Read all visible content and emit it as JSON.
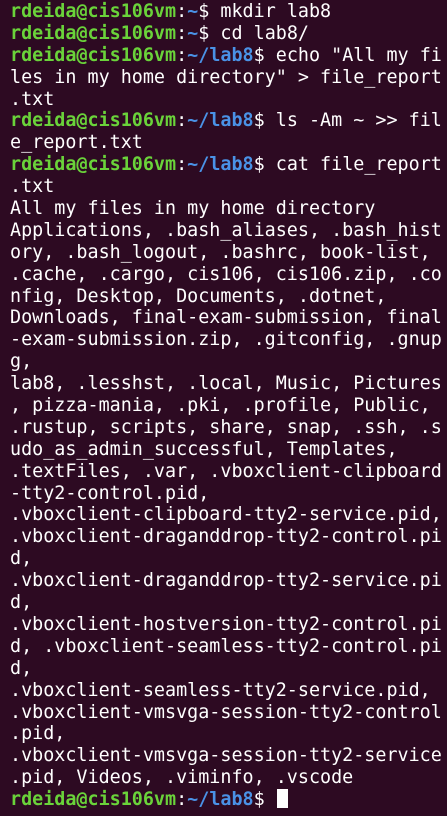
{
  "colors": {
    "background": "#2d0a22",
    "prompt_user": "#6ad33a",
    "prompt_path": "#4a92e6",
    "text": "#ffffff"
  },
  "prompt": {
    "userhost": "rdeida@cis106vm",
    "colon": ":",
    "dollar": "$"
  },
  "lines": [
    {
      "type": "prompt",
      "path": "~",
      "cmd": " mkdir lab8"
    },
    {
      "type": "prompt",
      "path": "~",
      "cmd": " cd lab8/"
    },
    {
      "type": "prompt",
      "path": "~/lab8",
      "cmd": " echo \"All my fi"
    },
    {
      "type": "output",
      "text": "les in my home directory\" > file_report"
    },
    {
      "type": "output",
      "text": ".txt"
    },
    {
      "type": "prompt",
      "path": "~/lab8",
      "cmd": " ls -Am ~ >> fil"
    },
    {
      "type": "output",
      "text": "e_report.txt"
    },
    {
      "type": "prompt",
      "path": "~/lab8",
      "cmd": " cat file_report"
    },
    {
      "type": "output",
      "text": ".txt"
    },
    {
      "type": "output",
      "text": "All my files in my home directory"
    },
    {
      "type": "output",
      "text": "Applications, .bash_aliases, .bash_hist"
    },
    {
      "type": "output",
      "text": "ory, .bash_logout, .bashrc, book-list,"
    },
    {
      "type": "output",
      "text": ".cache, .cargo, cis106, cis106.zip, .co"
    },
    {
      "type": "output",
      "text": "nfig, Desktop, Documents, .dotnet,"
    },
    {
      "type": "output",
      "text": "Downloads, final-exam-submission, final"
    },
    {
      "type": "output",
      "text": "-exam-submission.zip, .gitconfig, .gnup"
    },
    {
      "type": "output",
      "text": "g,"
    },
    {
      "type": "output",
      "text": "lab8, .lesshst, .local, Music, Pictures"
    },
    {
      "type": "output",
      "text": ", pizza-mania, .pki, .profile, Public,"
    },
    {
      "type": "output",
      "text": ".rustup, scripts, share, snap, .ssh, .s"
    },
    {
      "type": "output",
      "text": "udo_as_admin_successful, Templates,"
    },
    {
      "type": "output",
      "text": ".textFiles, .var, .vboxclient-clipboard"
    },
    {
      "type": "output",
      "text": "-tty2-control.pid,"
    },
    {
      "type": "output",
      "text": ".vboxclient-clipboard-tty2-service.pid,"
    },
    {
      "type": "output",
      "text": ".vboxclient-draganddrop-tty2-control.pi"
    },
    {
      "type": "output",
      "text": "d,"
    },
    {
      "type": "output",
      "text": ".vboxclient-draganddrop-tty2-service.pi"
    },
    {
      "type": "output",
      "text": "d,"
    },
    {
      "type": "output",
      "text": ".vboxclient-hostversion-tty2-control.pi"
    },
    {
      "type": "output",
      "text": "d, .vboxclient-seamless-tty2-control.pi"
    },
    {
      "type": "output",
      "text": "d,"
    },
    {
      "type": "output",
      "text": ".vboxclient-seamless-tty2-service.pid,"
    },
    {
      "type": "output",
      "text": ".vboxclient-vmsvga-session-tty2-control"
    },
    {
      "type": "output",
      "text": ".pid,"
    },
    {
      "type": "output",
      "text": ".vboxclient-vmsvga-session-tty2-service"
    },
    {
      "type": "output",
      "text": ".pid, Videos, .viminfo, .vscode"
    },
    {
      "type": "prompt",
      "path": "~/lab8",
      "cmd": " ",
      "cursor": true
    }
  ]
}
